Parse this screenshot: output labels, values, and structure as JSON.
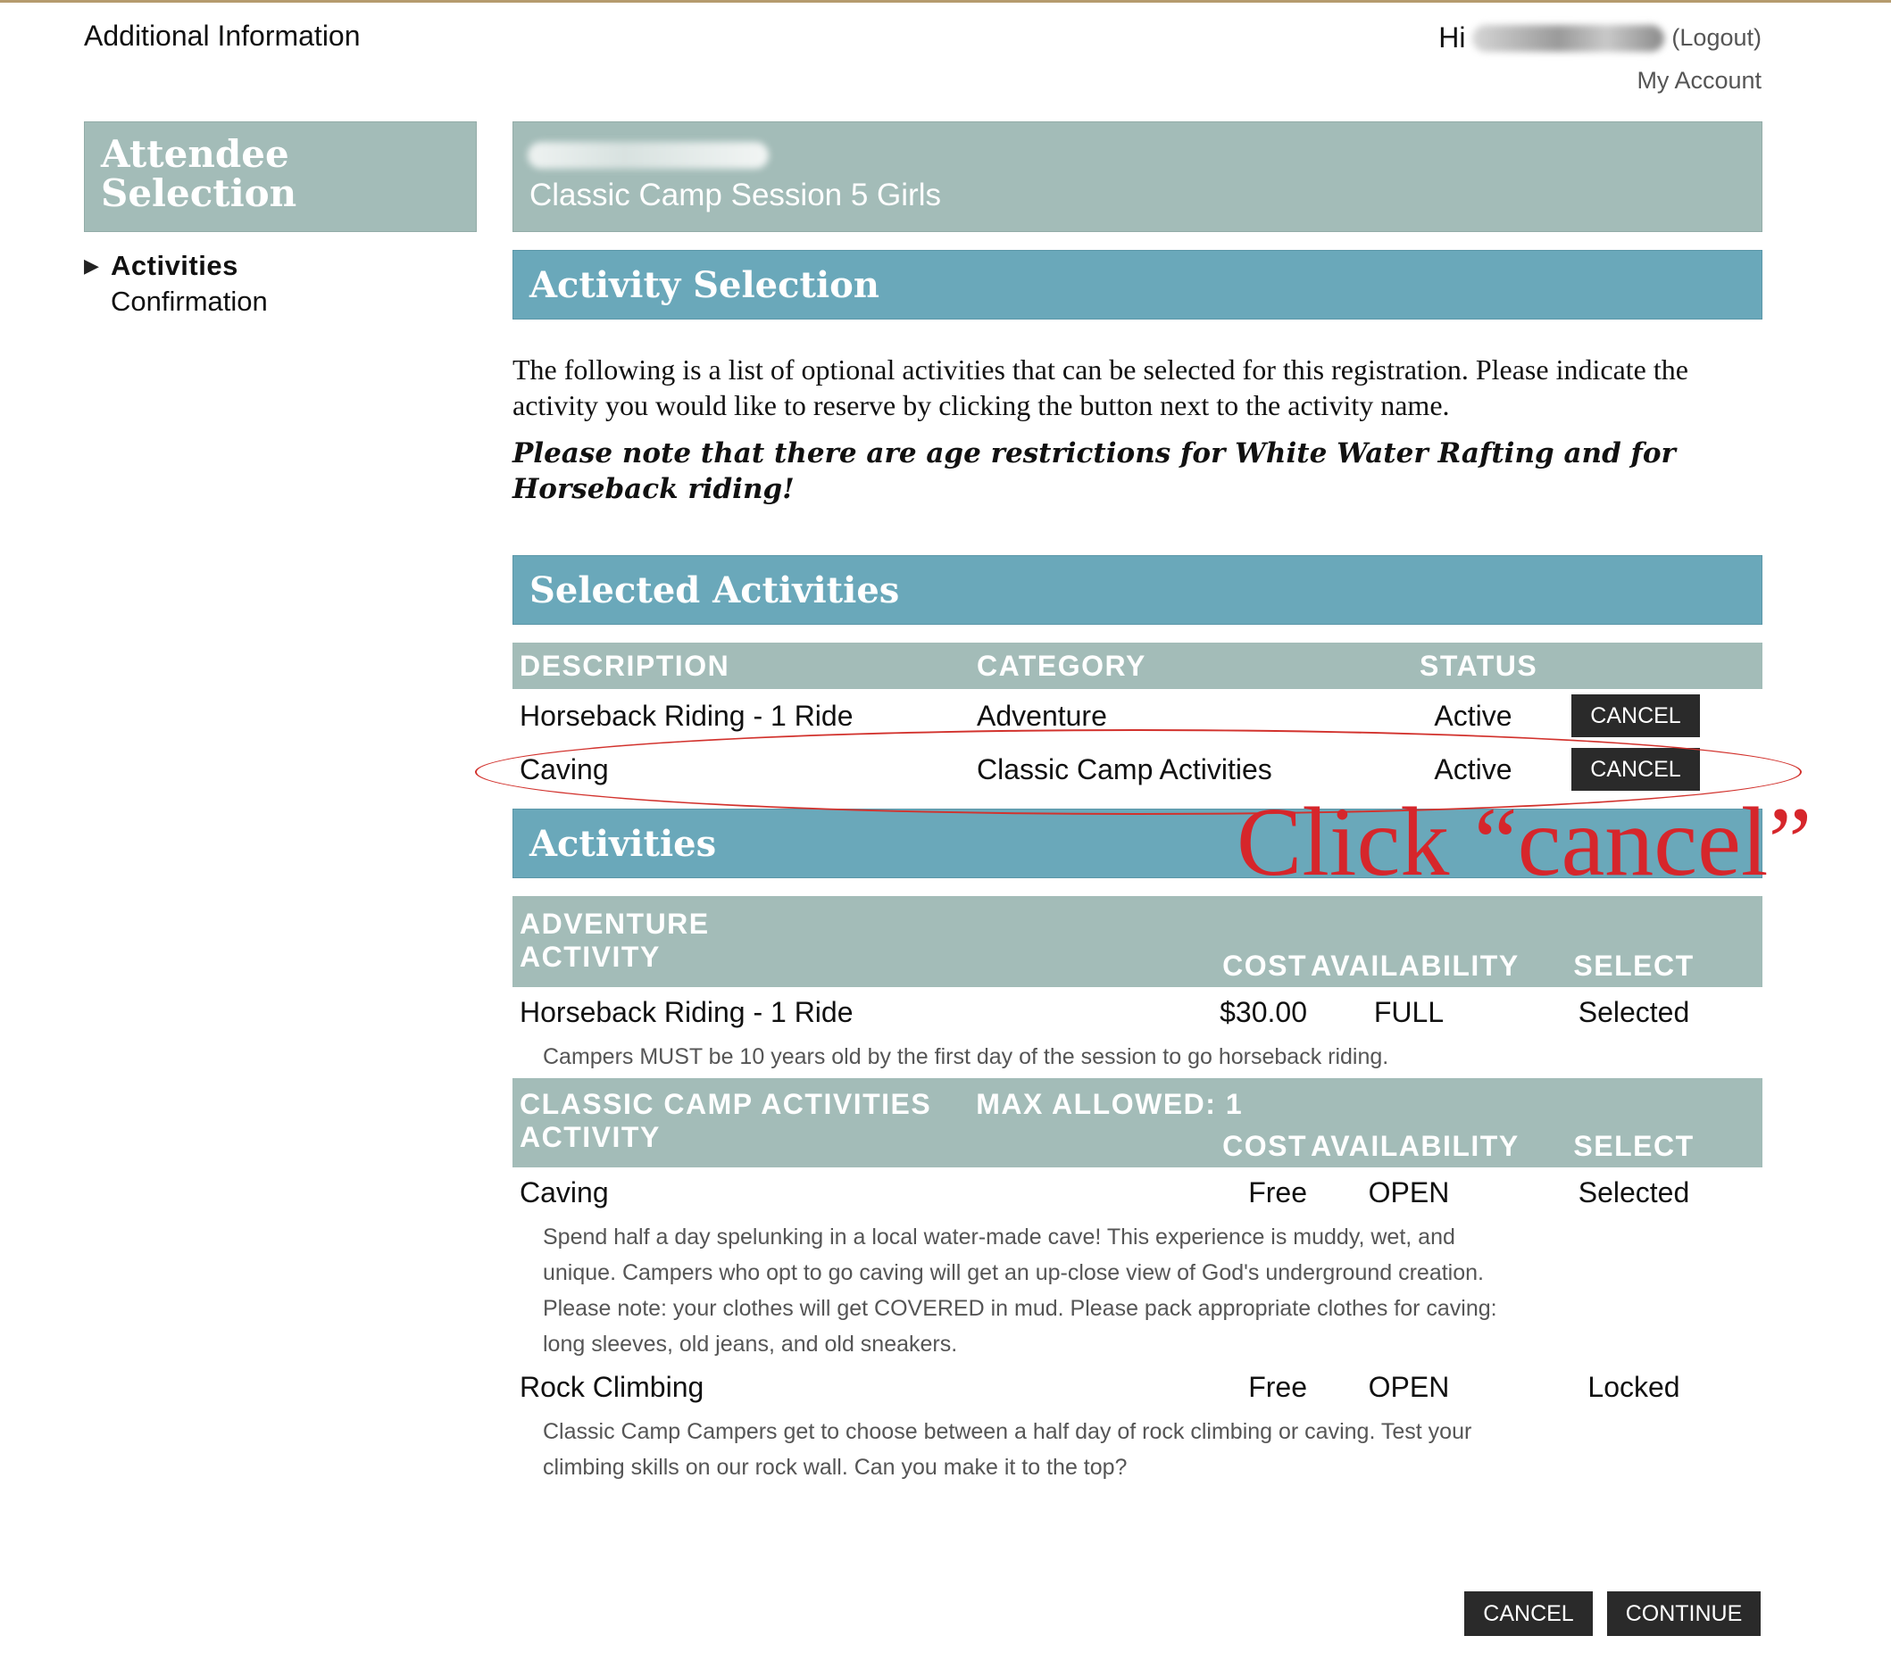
{
  "header": {
    "title": "Additional Information",
    "greeting": "Hi",
    "logout_label": "(Logout)",
    "my_account_label": "My Account"
  },
  "sidebar": {
    "heading": "Attendee\nSelection",
    "steps": [
      {
        "label": "Activities",
        "active": true
      },
      {
        "label": "Confirmation",
        "active": false
      }
    ]
  },
  "session": {
    "name": "Classic Camp Session 5 Girls"
  },
  "activity_selection": {
    "title": "Activity Selection",
    "intro": "The following is a list of optional activities that can be selected for this registration. Please indicate the activity you would like to reserve by clicking the button next to the activity name.",
    "note": "Please note that there are age restrictions for White Water Rafting and for Horseback riding!"
  },
  "selected": {
    "title": "Selected Activities",
    "headers": {
      "description": "DESCRIPTION",
      "category": "CATEGORY",
      "status": "STATUS"
    },
    "rows": [
      {
        "description": "Horseback Riding - 1 Ride",
        "category": "Adventure",
        "status": "Active",
        "button": "CANCEL"
      },
      {
        "description": "Caving",
        "category": "Classic Camp Activities",
        "status": "Active",
        "button": "CANCEL"
      }
    ]
  },
  "activities": {
    "title": "Activities",
    "headers": {
      "activity": "ACTIVITY",
      "cost": "COST",
      "availability": "AVAILABILITY",
      "select": "SELECT"
    },
    "categories": [
      {
        "name": "ADVENTURE",
        "max_allowed": "",
        "items": [
          {
            "name": "Horseback Riding - 1 Ride",
            "cost": "$30.00",
            "availability": "FULL",
            "select": "Selected",
            "description": "Campers MUST be 10 years old by the first day of the session to go horseback riding."
          }
        ]
      },
      {
        "name": "CLASSIC CAMP ACTIVITIES",
        "max_allowed": "MAX ALLOWED: 1",
        "items": [
          {
            "name": "Caving",
            "cost": "Free",
            "availability": "OPEN",
            "select": "Selected",
            "description": "Spend half a day spelunking in a local water-made cave! This experience is muddy, wet, and unique. Campers who opt to go caving will get an up-close view of God's underground creation. Please note: your clothes will get COVERED in mud. Please pack appropriate clothes for caving: long sleeves, old jeans, and old sneakers."
          },
          {
            "name": "Rock Climbing",
            "cost": "Free",
            "availability": "OPEN",
            "select": "Locked",
            "description": "Classic Camp Campers get to choose between a half day of rock climbing or caving. Test your climbing skills on our rock wall. Can you make it to the top?"
          }
        ]
      }
    ]
  },
  "footer": {
    "cancel_label": "CANCEL",
    "continue_label": "CONTINUE"
  },
  "annotation": {
    "text": "Click “cancel”",
    "color": "#d6262b"
  },
  "colors": {
    "sage": "#a3bcb8",
    "teal": "#6aa8ba",
    "button": "#2a2a2a"
  }
}
